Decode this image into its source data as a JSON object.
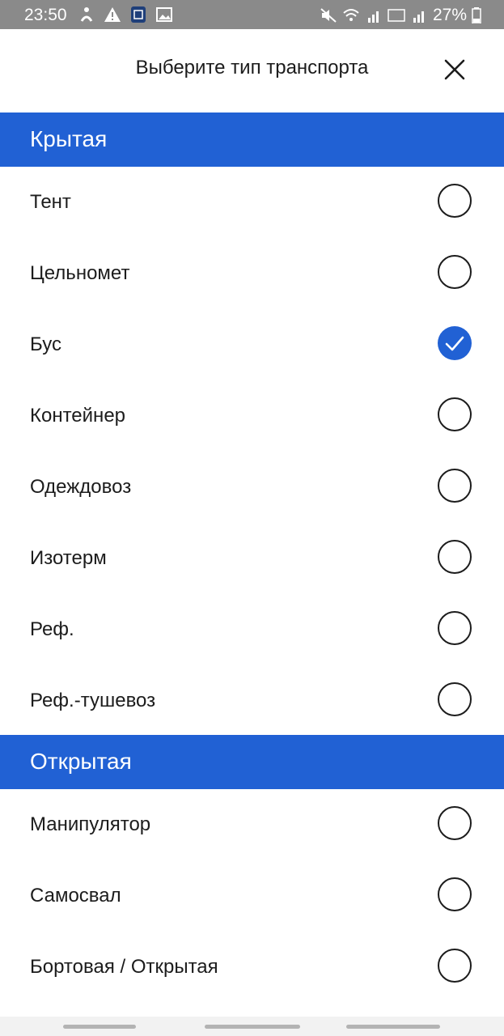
{
  "status_bar": {
    "time": "23:50",
    "battery": "27%",
    "icons_left": [
      "accessibility-icon",
      "warning-icon",
      "app-icon",
      "image-icon"
    ],
    "icons_right": [
      "mute-icon",
      "wifi-icon",
      "signal-icon",
      "volte-icon",
      "signal-icon",
      "battery-icon"
    ]
  },
  "header": {
    "title": "Выберите тип транспорта",
    "close_icon": "close-icon"
  },
  "sections": [
    {
      "title": "Крытая",
      "items": [
        {
          "label": "Тент",
          "checked": false
        },
        {
          "label": "Цельномет",
          "checked": false
        },
        {
          "label": "Бус",
          "checked": true
        },
        {
          "label": "Контейнер",
          "checked": false
        },
        {
          "label": "Одеждовоз",
          "checked": false
        },
        {
          "label": "Изотерм",
          "checked": false
        },
        {
          "label": "Реф.",
          "checked": false
        },
        {
          "label": "Реф.-тушевоз",
          "checked": false
        }
      ]
    },
    {
      "title": "Открытая",
      "items": [
        {
          "label": "Манипулятор",
          "checked": false
        },
        {
          "label": "Самосвал",
          "checked": false
        },
        {
          "label": "Бортовая / Открытая",
          "checked": false
        }
      ]
    }
  ],
  "colors": {
    "accent": "#2161d4",
    "status_bar": "#8a8a8a",
    "text": "#1c1c1c"
  }
}
